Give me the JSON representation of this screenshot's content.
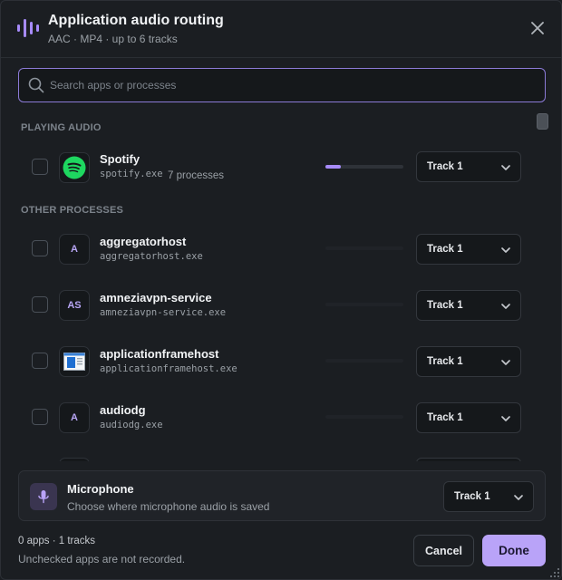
{
  "header": {
    "title": "Application audio routing",
    "subtitle": "AAC · MP4 · up to 6 tracks"
  },
  "search": {
    "placeholder": "Search apps or processes"
  },
  "sections": {
    "playing": "PLAYING AUDIO",
    "other": "OTHER PROCESSES"
  },
  "playing_apps": [
    {
      "name": "Spotify",
      "exe": "spotify.exe",
      "processes": "7 processes",
      "track": "Track 1",
      "level": 0.2,
      "checked": false
    }
  ],
  "other_apps": [
    {
      "name": "aggregatorhost",
      "exe": "aggregatorhost.exe",
      "avatar": "A",
      "track": "Track 1",
      "checked": false
    },
    {
      "name": "amneziavpn-service",
      "exe": "amneziavpn-service.exe",
      "avatar": "AS",
      "track": "Track 1",
      "checked": false
    },
    {
      "name": "applicationframehost",
      "exe": "applicationframehost.exe",
      "avatar": "window-icon",
      "track": "Track 1",
      "checked": false
    },
    {
      "name": "audiodg",
      "exe": "audiodg.exe",
      "avatar": "A",
      "track": "Track 1",
      "checked": false
    }
  ],
  "microphone": {
    "title": "Microphone",
    "description": "Choose where microphone audio is saved",
    "track": "Track 1"
  },
  "footer": {
    "summary": "0 apps · 1 tracks",
    "note": "Unchecked apps are not recorded.",
    "cancel_label": "Cancel",
    "done_label": "Done"
  },
  "colors": {
    "accent": "#a78bfa",
    "done_button": "#b9a3f8",
    "spotify": "#1ed760",
    "background": "#1b1e22"
  },
  "icons": [
    "audio-bars-icon",
    "close-icon",
    "search-icon",
    "spotify-icon",
    "window-icon",
    "chevron-down-icon",
    "microphone-icon",
    "resize-grip-icon"
  ]
}
